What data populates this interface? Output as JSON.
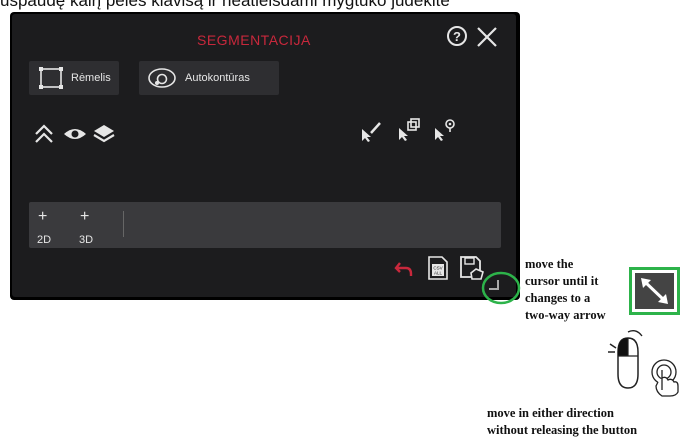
{
  "top_text": "uspaudę kairį pelės klavišą ir neatleisdami mygtuko judėkite",
  "panel": {
    "title": "SEGMENTACIJA",
    "help_label": "?",
    "modes": [
      {
        "label": "Rėmelis",
        "icon": "frame-icon"
      },
      {
        "label": "Autokontūras",
        "icon": "autocontour-icon"
      }
    ],
    "view_icons": [
      "collapse-up-icon",
      "eye-icon",
      "layers-icon"
    ],
    "tool_icons": [
      "brush-cursor-icon",
      "copy-cursor-icon",
      "pin-cursor-icon"
    ],
    "add_buttons": [
      {
        "plus": "+",
        "sub": "2D"
      },
      {
        "plus": "+",
        "sub": "3D"
      }
    ],
    "bottom_icons": [
      "undo-icon",
      "csv-all-icon",
      "save-shape-icon"
    ],
    "accent_color": "#c8283c"
  },
  "annotations": {
    "cursor_hint": [
      "move the",
      "cursor until it",
      "changes to a",
      "two-way arrow"
    ],
    "drag_hint": [
      "move in either direction",
      "without releasing the button"
    ]
  }
}
